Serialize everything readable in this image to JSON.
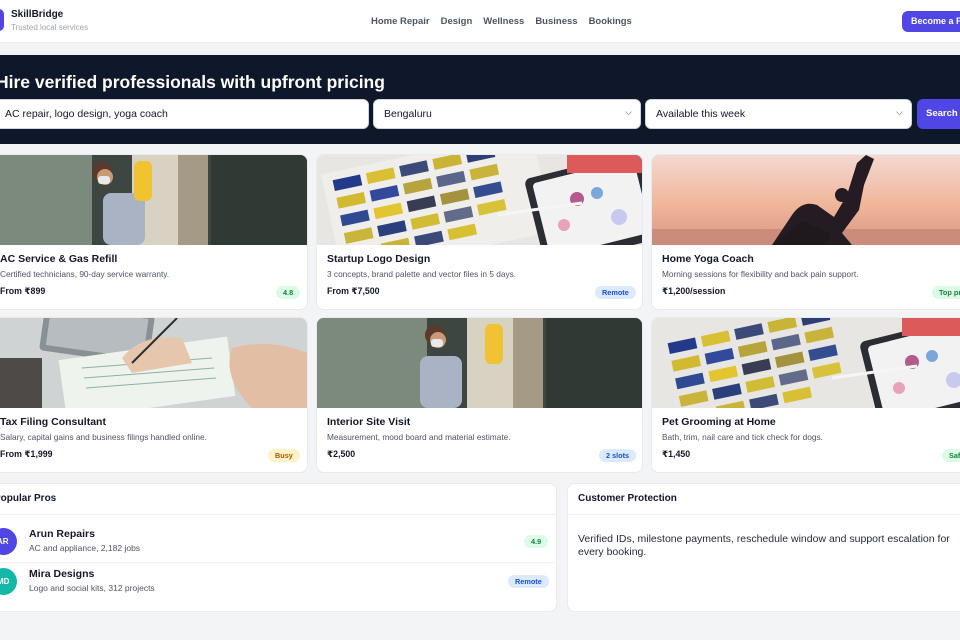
{
  "header": {
    "brand_name": "SkillBridge",
    "brand_tagline": "Trusted local services",
    "nav": [
      "Home Repair",
      "Design",
      "Wellness",
      "Business",
      "Bookings"
    ],
    "cta_label": "Become a Pro"
  },
  "hero": {
    "title": "Hire verified professionals with upfront pricing",
    "search_value": "AC repair, logo design, yoga coach",
    "city_value": "Bengaluru",
    "availability_value": "Available this week",
    "search_button": "Search"
  },
  "cards": [
    {
      "title": "AC Service & Gas Refill",
      "desc": "Certified technicians, 90-day service warranty.",
      "price": "From ₹899",
      "badge": "4.8",
      "badge_tone": "green",
      "image": "cleaning-photo"
    },
    {
      "title": "Startup Logo Design",
      "desc": "3 concepts, brand palette and vector files in 5 days.",
      "price": "From ₹7,500",
      "badge": "Remote",
      "badge_tone": "blue",
      "image": "color-swatch-photo"
    },
    {
      "title": "Home Yoga Coach",
      "desc": "Morning sessions for flexibility and back pain support.",
      "price": "₹1,200/session",
      "badge": "Top pro",
      "badge_tone": "green",
      "image": "yoga-sunset-photo"
    },
    {
      "title": "Tax Filing Consultant",
      "desc": "Salary, capital gains and business filings handled online.",
      "price": "From ₹1,999",
      "badge": "Busy",
      "badge_tone": "amber",
      "image": "paperwork-photo"
    },
    {
      "title": "Interior Site Visit",
      "desc": "Measurement, mood board and material estimate.",
      "price": "₹2,500",
      "badge": "2 slots",
      "badge_tone": "blue",
      "image": "cleaning-photo"
    },
    {
      "title": "Pet Grooming at Home",
      "desc": "Bath, trim, nail care and tick check for dogs.",
      "price": "₹1,450",
      "badge": "Safe",
      "badge_tone": "green",
      "image": "color-swatch-photo"
    }
  ],
  "popular_pros": {
    "heading": "Popular Pros",
    "items": [
      {
        "initials": "AR",
        "name": "Arun Repairs",
        "meta": "AC and appliance, 2,182 jobs",
        "badge": "4.9",
        "badge_tone": "green",
        "avatar_color": "#4f46e5"
      },
      {
        "initials": "MD",
        "name": "Mira Designs",
        "meta": "Logo and social kits, 312 projects",
        "badge": "Remote",
        "badge_tone": "blue",
        "avatar_color": "#14b8a6"
      }
    ]
  },
  "protection": {
    "heading": "Customer Protection",
    "text": "Verified IDs, milestone payments, reschedule window and support escalation for every booking."
  },
  "colors": {
    "accent": "#4f46e5",
    "hero_bg": "#0f172a",
    "page_bg": "#f3f4f6"
  }
}
